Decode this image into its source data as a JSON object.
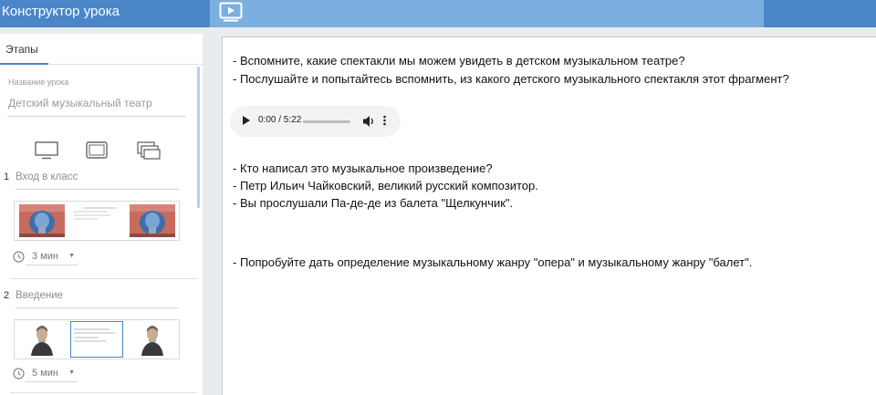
{
  "app": {
    "title": "Конструктор урока"
  },
  "sidebar": {
    "tab_label": "Этапы",
    "lesson_label": "Название урока",
    "lesson_name": "Детский музыкальный театр",
    "devices": [
      "tv-icon",
      "tablet-icon",
      "multi-screen-icon"
    ],
    "stages": [
      {
        "number": "1",
        "name": "Вход в класс",
        "time": "3 мин"
      },
      {
        "number": "2",
        "name": "Введение",
        "time": "5 мин"
      }
    ]
  },
  "content": {
    "lines": [
      "- Вспомните, какие спектакли мы можем увидеть в детском музыкальном театре?",
      "- Послушайте и попытайтесь вспомнить, из какого детского музыкального спектакля этот фрагмент?",
      "- Кто написал это музыкальное произведение?",
      "- Петр Ильич Чайковский, великий русский композитор.",
      "- Вы прослушали Па-де-де из балета \"Щелкунчик\".",
      "- Попробуйте дать определение музыкальному жанру \"опера\" и музыкальному жанру \"балет\"."
    ],
    "audio": {
      "time": "0:00 / 5:22",
      "progress": 0
    }
  },
  "colors": {
    "accent": "#4a86c8",
    "topbar_light": "#7bafe0"
  }
}
